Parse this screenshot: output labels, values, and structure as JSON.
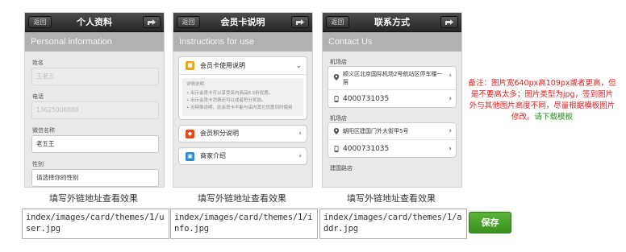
{
  "phones": [
    {
      "back_label": "返回",
      "title": "个人资料",
      "header": "Personal information",
      "fields": [
        {
          "label": "姓名",
          "value": "王老五",
          "readonly": true
        },
        {
          "label": "电话",
          "value": "13625008888",
          "readonly": true
        },
        {
          "label": "微信名称",
          "value": "老五王",
          "readonly": false
        },
        {
          "label": "性别",
          "value": "请选择你的性别",
          "readonly": false
        }
      ]
    },
    {
      "back_label": "返回",
      "title": "会员卡说明",
      "header": "Instructions for use",
      "accordion": {
        "title": "会员卡使用说明",
        "body_title": "详情说明",
        "body_lines": [
          "• 出示会员卡可以享受店内商品8.5折优惠。",
          "• 出示会员卡消费还可以成者积分奖励。",
          "• 无特殊说明，此会员卡不能与店内其它优惠同时使用"
        ]
      },
      "cards": [
        {
          "label": "会员积分说明",
          "icon": "points-icon"
        },
        {
          "label": "商家介绍",
          "icon": "shop-icon"
        }
      ]
    },
    {
      "back_label": "返回",
      "title": "联系方式",
      "header": "Contact Us",
      "stores": [
        {
          "name": "机场店",
          "address": "顺义区北京国际机场2号航站区停车楼一层",
          "phone": "4000731035"
        },
        {
          "name": "机场店",
          "address": "朝阳区建国门外大街甲5号",
          "phone": "4000731035"
        },
        {
          "name": "建国路店"
        }
      ]
    }
  ],
  "captions": [
    "填写外链地址查看效果",
    "填写外链地址查看效果",
    "填写外链地址查看效果"
  ],
  "urls": [
    "index/images/card/themes/1/user.jpg",
    "index/images/card/themes/1/info.jpg",
    "index/images/card/themes/1/addr.jpg"
  ],
  "save_label": "保存",
  "note": {
    "text": "备注：图片宽640px高109px或者更高，但是不要高太多；图片类型为jpg，签到图片外与其他图片高度不同，尽量根据模板图片修改。",
    "link": "请下载模板"
  },
  "colors": {
    "save_green": "#4aa52a",
    "note_red": "#e21d1d",
    "link_green": "#2e8b1f",
    "accent_orange": "#e8a317",
    "accent_red": "#e04a1a",
    "accent_blue": "#2a8ad4"
  }
}
